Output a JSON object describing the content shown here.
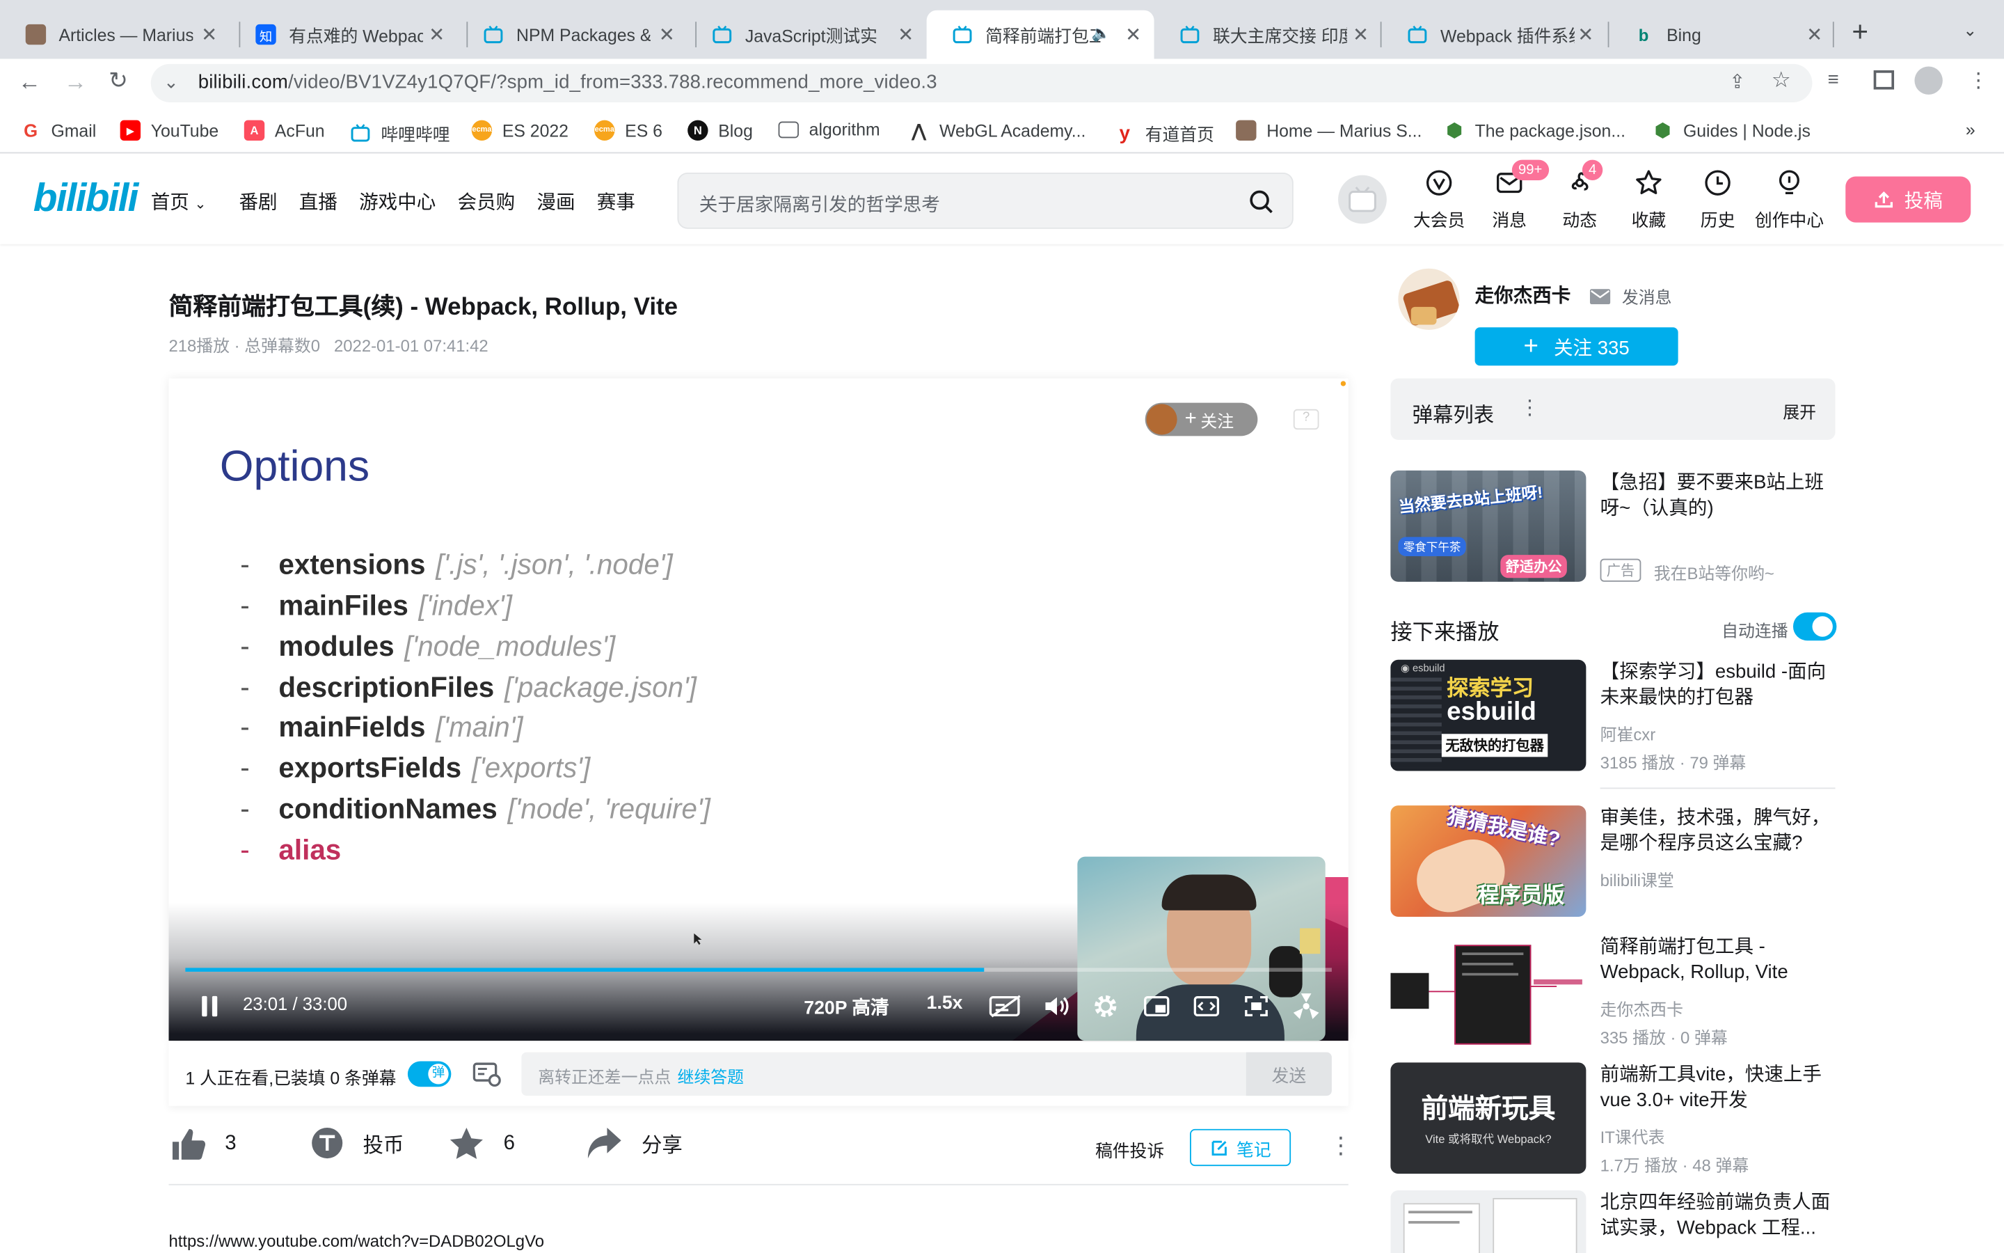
{
  "browser": {
    "tabs": [
      {
        "title": "Articles — Marius",
        "icon": "avatar-icon"
      },
      {
        "title": "有点难的 Webpack",
        "icon": "zhihu-icon"
      },
      {
        "title": "NPM Packages &",
        "icon": "bilibili-tv-icon"
      },
      {
        "title": "JavaScript测试实",
        "icon": "bilibili-tv-icon"
      },
      {
        "title": "简释前端打包工",
        "icon": "bilibili-tv-icon"
      },
      {
        "title": "联大主席交接 印度",
        "icon": "bilibili-tv-icon"
      },
      {
        "title": "Webpack 插件系统",
        "icon": "bilibili-tv-icon"
      },
      {
        "title": "Bing",
        "icon": "bing-icon"
      }
    ],
    "active_tab_index": 4,
    "url_host": "bilibili.com",
    "url_path": "/video/BV1VZ4y1Q7QF/?spm_id_from=333.788.recommend_more_video.3",
    "bookmarks": [
      {
        "label": "Gmail",
        "color": "#ea4335",
        "mark": "G"
      },
      {
        "label": "YouTube",
        "color": "#ff0000",
        "mark": "▶"
      },
      {
        "label": "AcFun",
        "color": "#fd4c5d",
        "mark": "A"
      },
      {
        "label": "哔哩哔哩",
        "color": "#00a1d6",
        "mark": "b"
      },
      {
        "label": "ES 2022",
        "color": "#f7a51c",
        "mark": "ecma"
      },
      {
        "label": "ES 6",
        "color": "#f7a51c",
        "mark": "ecma"
      },
      {
        "label": "Blog",
        "color": "#111111",
        "mark": "N"
      },
      {
        "label": "algorithm",
        "color": "#5f6368",
        "mark": "▭"
      },
      {
        "label": "WebGL Academy...",
        "color": "#333333",
        "mark": "◠"
      },
      {
        "label": "有道首页",
        "color": "#e1251b",
        "mark": "y"
      },
      {
        "label": "Home — Marius S...",
        "color": "#8a6d5a",
        "mark": "M"
      },
      {
        "label": "The package.json...",
        "color": "#3c873a",
        "mark": "⬢"
      },
      {
        "label": "Guides | Node.js",
        "color": "#3c873a",
        "mark": "⬢"
      }
    ],
    "overflow": "»"
  },
  "site": {
    "logo": "bilibili",
    "nav": [
      "首页",
      "番剧",
      "直播",
      "游戏中心",
      "会员购",
      "漫画",
      "赛事"
    ],
    "search_placeholder": "关于居家隔离引发的哲学思考",
    "header_icons": [
      {
        "label": "大会员",
        "icon": "vip-icon"
      },
      {
        "label": "消息",
        "icon": "message-icon",
        "badge": "99+"
      },
      {
        "label": "动态",
        "icon": "dynamic-icon",
        "badge": "4"
      },
      {
        "label": "收藏",
        "icon": "star-icon"
      },
      {
        "label": "历史",
        "icon": "clock-icon"
      },
      {
        "label": "创作中心",
        "icon": "bulb-icon"
      }
    ],
    "upload_label": "投稿"
  },
  "video": {
    "title": "简释前端打包工具(续) - Webpack, Rollup, Vite",
    "stats": "218播放 · 总弹幕数0",
    "date": "2022-01-01 07:41:42",
    "slide": {
      "heading": "Options",
      "items": [
        {
          "name": "extensions",
          "value": "['.js', '.json', '.node']"
        },
        {
          "name": "mainFiles",
          "value": "['index']"
        },
        {
          "name": "modules",
          "value": "['node_modules']"
        },
        {
          "name": "descriptionFiles",
          "value": "['package.json']"
        },
        {
          "name": "mainFields",
          "value": "['main']"
        },
        {
          "name": "exportsFields",
          "value": "['exports']"
        },
        {
          "name": "conditionNames",
          "value": "['node', 'require']"
        },
        {
          "name": "alias",
          "value": ""
        }
      ]
    },
    "overlay_follow": "关注",
    "player": {
      "time": "23:01 / 33:00",
      "progress": 0.697,
      "quality": "720P 高清",
      "speed": "1.5x"
    },
    "danmaku_bar": {
      "watching": "1 人正在看,已装填 0 条弹幕",
      "toggle": "弹",
      "input_placeholder": "离转正还差一点点",
      "input_link": "继续答题",
      "send": "发送"
    },
    "actions": {
      "like": "3",
      "coin": "投币",
      "fav": "6",
      "share": "分享",
      "report": "稿件投诉",
      "note": "笔记"
    },
    "desc_link": "https://www.youtube.com/watch?v=DADB02OLgVo"
  },
  "sidebar": {
    "author": "走你杰西卡",
    "message": "发消息",
    "follow": "关注 335",
    "danmaku_list": "弹幕列表",
    "expand": "展开",
    "ad": {
      "title": "【急招】要不要来B站上班呀~（认真的)",
      "tag": "广告",
      "sub": "我在B站等你哟~",
      "thumb_text1": "当然要去B站上班呀!",
      "thumb_text2": "零食下午茶",
      "thumb_text3": "舒适办公"
    },
    "next_label": "接下来播放",
    "autoplay": "自动连播",
    "recs": [
      {
        "title": "【探索学习】esbuild -面向未来最快的打包器",
        "author": "阿崔cxr",
        "stats": "3185 播放 · 79 弹幕",
        "thumb_text1": "探索学习",
        "thumb_text2": "esbuild",
        "thumb_text3": "无敌快的打包器"
      },
      {
        "title": "审美佳，技术强，脾气好，是哪个程序员这么宝藏?",
        "author": "bilibili课堂",
        "stats": "",
        "thumb_text1": "猜猜我是谁?",
        "thumb_text2": "程序员版"
      },
      {
        "title": "简释前端打包工具 - Webpack, Rollup, Vite",
        "author": "走你杰西卡",
        "stats": "335 播放 · 0 弹幕"
      },
      {
        "title": "前端新工具vite，快速上手vue 3.0+ vite开发",
        "author": "IT课代表",
        "stats": "1.7万 播放 · 48 弹幕",
        "thumb_text1": "前端新玩具",
        "thumb_text2": "Vite 或将取代 Webpack?"
      },
      {
        "title": "北京四年经验前端负责人面试实录，Webpack 工程..."
      }
    ]
  },
  "colors": {
    "accent": "#00aeec",
    "pink": "#fb7299",
    "slide_heading": "#2c3a8a",
    "alias": "#c0305c"
  }
}
